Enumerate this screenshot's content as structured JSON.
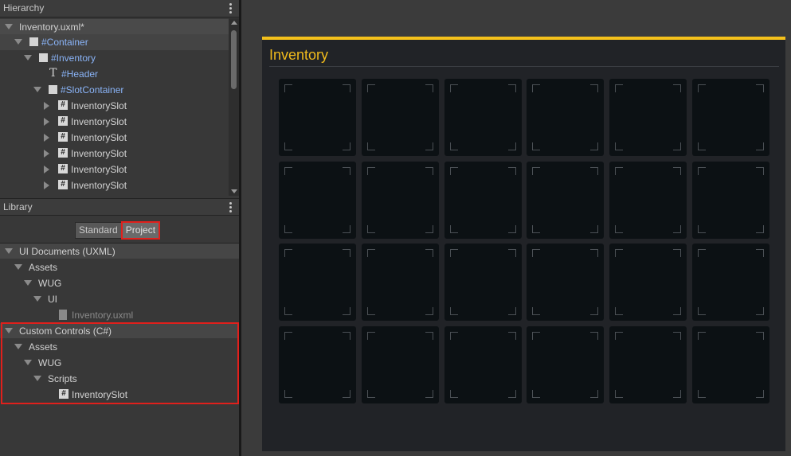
{
  "hierarchy": {
    "title": "Hierarchy",
    "rows": [
      {
        "label": "Inventory.uxml*"
      },
      {
        "label": "#Container"
      },
      {
        "label": "#Inventory"
      },
      {
        "label": "#Header"
      },
      {
        "label": "#SlotContainer"
      },
      {
        "label": "InventorySlot"
      },
      {
        "label": "InventorySlot"
      },
      {
        "label": "InventorySlot"
      },
      {
        "label": "InventorySlot"
      },
      {
        "label": "InventorySlot"
      },
      {
        "label": "InventorySlot"
      }
    ]
  },
  "library": {
    "title": "Library",
    "tabs": {
      "standard": "Standard",
      "project": "Project"
    },
    "ui_documents": {
      "header": "UI Documents (UXML)",
      "items": [
        "Assets",
        "WUG",
        "UI",
        "Inventory.uxml"
      ]
    },
    "custom_controls": {
      "header": "Custom Controls (C#)",
      "items": [
        "Assets",
        "WUG",
        "Scripts",
        "InventorySlot"
      ]
    }
  },
  "canvas": {
    "title": "Inventory",
    "accent": "#f5c11b",
    "slot_rows": 4,
    "slot_cols": 6
  },
  "colors": {
    "selection_outline": "#e0201c",
    "element_blue": "#8ab4f8"
  }
}
